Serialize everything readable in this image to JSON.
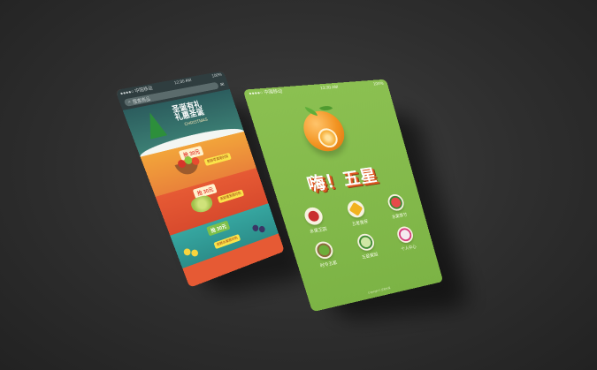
{
  "left_phone": {
    "status": {
      "carrier": "●●●●○ 中国移动",
      "time": "12:30 AM",
      "battery": "100%"
    },
    "search": {
      "placeholder": "搜索商品"
    },
    "banner": {
      "title_line1": "圣诞有礼",
      "title_line2": "礼惠圣诞",
      "subtitle": "CHRISTMAS"
    },
    "sections": [
      {
        "tag": "抢 30元",
        "cta": "新鲜苹果限时购"
      },
      {
        "tag": "抢 30元",
        "cta": "新鲜葡萄限时购"
      },
      {
        "tag": "抢 30元",
        "cta": "新鲜水果限时购"
      }
    ]
  },
  "right_phone": {
    "status": {
      "carrier": "●●●●○ 中国移动",
      "time": "12:30 AM",
      "battery": "100%"
    },
    "brand": "嗨！五星",
    "categories": [
      {
        "label": "水果王国"
      },
      {
        "label": "五星推荐"
      },
      {
        "label": "水果季节"
      },
      {
        "label": "时令五星"
      },
      {
        "label": "五星果园"
      },
      {
        "label": "个人中心"
      }
    ],
    "footer": "Copyright © 五星水果"
  },
  "colors": {
    "background": "#2e2e2e",
    "right_phone_green": "#7cb345",
    "left_phone_header": "#2f3d3f",
    "accent_orange": "#f29321"
  }
}
